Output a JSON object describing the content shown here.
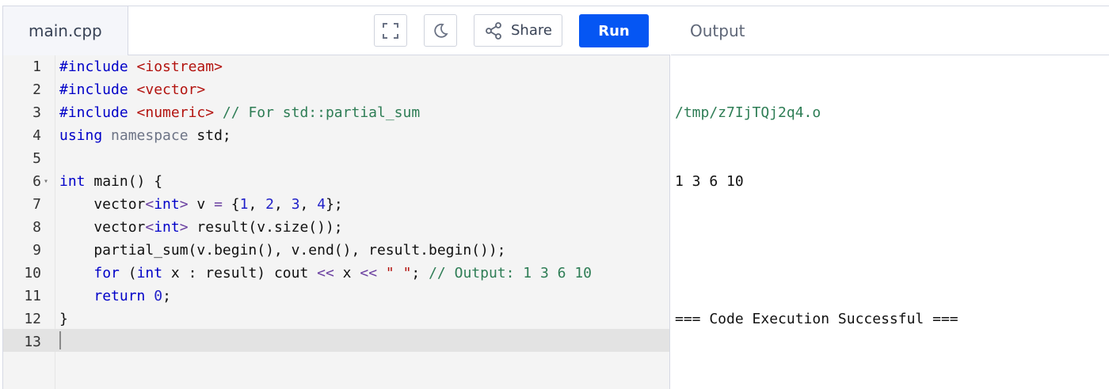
{
  "editor": {
    "tab_label": "main.cpp",
    "toolbar": {
      "fullscreen_icon": "fullscreen-icon",
      "theme_icon": "moon-icon",
      "share_label": "Share",
      "share_icon": "share-icon",
      "run_label": "Run"
    },
    "active_line": 13,
    "lines": [
      {
        "n": "1",
        "tokens": [
          {
            "t": "#include ",
            "c": "kw"
          },
          {
            "t": "<iostream>",
            "c": "str"
          }
        ]
      },
      {
        "n": "2",
        "tokens": [
          {
            "t": "#include ",
            "c": "kw"
          },
          {
            "t": "<vector>",
            "c": "str"
          }
        ]
      },
      {
        "n": "3",
        "tokens": [
          {
            "t": "#include ",
            "c": "kw"
          },
          {
            "t": "<numeric>",
            "c": "str"
          },
          {
            "t": " // For std::partial_sum",
            "c": "cm"
          }
        ]
      },
      {
        "n": "4",
        "tokens": [
          {
            "t": "using",
            "c": "kw"
          },
          {
            "t": " namespace",
            "c": "kw2"
          },
          {
            "t": " std;",
            "c": ""
          }
        ]
      },
      {
        "n": "5",
        "tokens": []
      },
      {
        "n": "6",
        "fold": true,
        "tokens": [
          {
            "t": "int",
            "c": "kw"
          },
          {
            "t": " main() {",
            "c": ""
          }
        ]
      },
      {
        "n": "7",
        "tokens": [
          {
            "t": "    vector",
            "c": ""
          },
          {
            "t": "<",
            "c": "op"
          },
          {
            "t": "int",
            "c": "kw"
          },
          {
            "t": ">",
            "c": "op"
          },
          {
            "t": " v ",
            "c": ""
          },
          {
            "t": "=",
            "c": "op"
          },
          {
            "t": " {",
            "c": ""
          },
          {
            "t": "1",
            "c": "num"
          },
          {
            "t": ", ",
            "c": ""
          },
          {
            "t": "2",
            "c": "num"
          },
          {
            "t": ", ",
            "c": ""
          },
          {
            "t": "3",
            "c": "num"
          },
          {
            "t": ", ",
            "c": ""
          },
          {
            "t": "4",
            "c": "num"
          },
          {
            "t": "};",
            "c": ""
          }
        ]
      },
      {
        "n": "8",
        "tokens": [
          {
            "t": "    vector",
            "c": ""
          },
          {
            "t": "<",
            "c": "op"
          },
          {
            "t": "int",
            "c": "kw"
          },
          {
            "t": ">",
            "c": "op"
          },
          {
            "t": " result(v.size());",
            "c": ""
          }
        ]
      },
      {
        "n": "9",
        "tokens": [
          {
            "t": "    partial_sum(v.begin(), v.end(), result.begin());",
            "c": ""
          }
        ]
      },
      {
        "n": "10",
        "tokens": [
          {
            "t": "    ",
            "c": ""
          },
          {
            "t": "for",
            "c": "kw"
          },
          {
            "t": " (",
            "c": ""
          },
          {
            "t": "int",
            "c": "kw"
          },
          {
            "t": " x : result) cout ",
            "c": ""
          },
          {
            "t": "<<",
            "c": "op"
          },
          {
            "t": " x ",
            "c": ""
          },
          {
            "t": "<<",
            "c": "op"
          },
          {
            "t": " ",
            "c": ""
          },
          {
            "t": "\" \"",
            "c": "str"
          },
          {
            "t": "; ",
            "c": ""
          },
          {
            "t": "// Output: 1 3 6 10",
            "c": "cm"
          }
        ]
      },
      {
        "n": "11",
        "tokens": [
          {
            "t": "    ",
            "c": ""
          },
          {
            "t": "return",
            "c": "kw"
          },
          {
            "t": " ",
            "c": ""
          },
          {
            "t": "0",
            "c": "num"
          },
          {
            "t": ";",
            "c": ""
          }
        ]
      },
      {
        "n": "12",
        "tokens": [
          {
            "t": "}",
            "c": ""
          }
        ]
      },
      {
        "n": "13",
        "tokens": []
      }
    ]
  },
  "output": {
    "title": "Output",
    "path": "/tmp/z7IjTQj2q4.o",
    "result": "1 3 6 10",
    "blank": "",
    "status": "=== Code Execution Successful ==="
  },
  "colors": {
    "run_button": "#0556f3",
    "keyword": "#0000c8",
    "string": "#b3130f",
    "comment": "#2e7d55"
  }
}
